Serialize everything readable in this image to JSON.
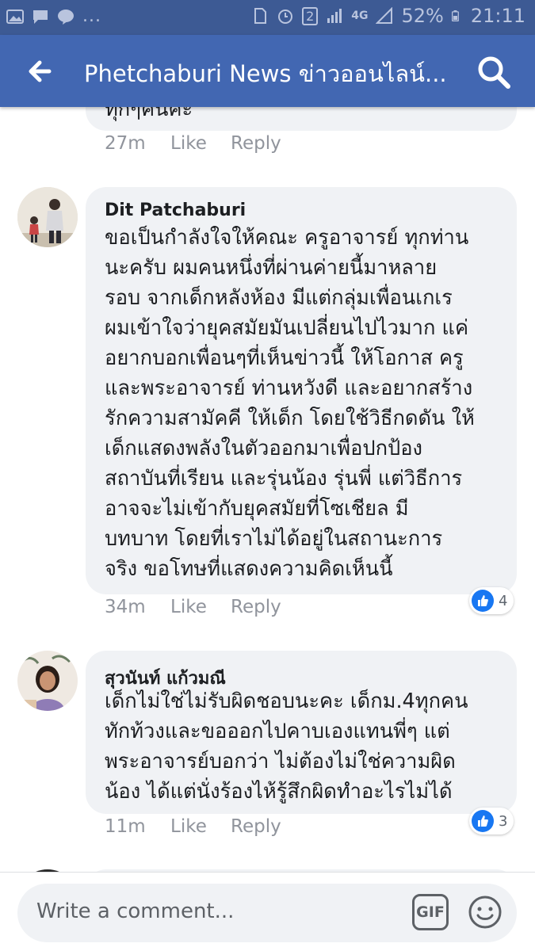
{
  "status_bar": {
    "battery": "52%",
    "time": "21:11",
    "network": "4G",
    "sim_badge": "2",
    "more": "..."
  },
  "header": {
    "title": "Phetchaburi News ข่าวออนไลน์..."
  },
  "comments": [
    {
      "text": "ทุกๆคนค่ะ",
      "time": "27m",
      "like_label": "Like",
      "reply_label": "Reply"
    },
    {
      "author": "Dit Patchaburi",
      "text": "ขอเป็นกำลังใจให้คณะ ครูอาจารย์ ทุกท่าน\nนะครับ ผมคนหนึ่งที่ผ่านค่ายนี้มาหลาย\nรอบ จากเด็กหลังห้อง  มีแต่กลุ่มเพื่อนเกเร\nผมเข้าใจว่ายุคสมัยมันเปลี่ยนไปไวมาก แค่\nอยากบอกเพื่อนๆที่เห็นข่าวนี้ ให้โอกาส ครู\nและพระอาจารย์ ท่านหวังดี และอยากสร้าง\nรักความสามัคคี ให้เด็ก โดยใช้วิธีกดดัน ให้\nเด็กแสดงพลังในตัวออกมาเพื่อปกป้อง\nสถาบันที่เรียน และรุ่นน้อง รุ่นพี่ แต่วิธีการ\nอาจจะไม่เข้ากับยุคสมัยที่โซเชียล มี\nบทบาท โดยที่เราไม่ได้อยู่ในสถานะการ\nจริง ขอโทษที่แสดงความคิดเห็นนี้",
      "time": "34m",
      "like_label": "Like",
      "reply_label": "Reply",
      "reaction_count": "4"
    },
    {
      "author": "สุวนันท์ แก้วมณี",
      "text": "เด็กไม่ใช่ไม่รับผิดชอบนะคะ เด็กม.4ทุกคน\nทักท้วงและขอออกไปคาบเองแทนพี่ๆ แต่\nพระอาจารย์บอกว่า ไม่ต้องไม่ใช่ความผิด\nน้อง ได้แต่นั่งร้องไห้รู้สึกผิดทำอะไรไม่ได้",
      "time": "11m",
      "like_label": "Like",
      "reply_label": "Reply",
      "reaction_count": "3"
    }
  ],
  "composer": {
    "placeholder": "Write a comment...",
    "gif_label": "GIF"
  },
  "colors": {
    "header_bg": "#4267b2",
    "status_bg": "#3d5a94",
    "bubble_bg": "#f0f2f5",
    "like_blue": "#1877f2",
    "meta_gray": "#90949c"
  }
}
